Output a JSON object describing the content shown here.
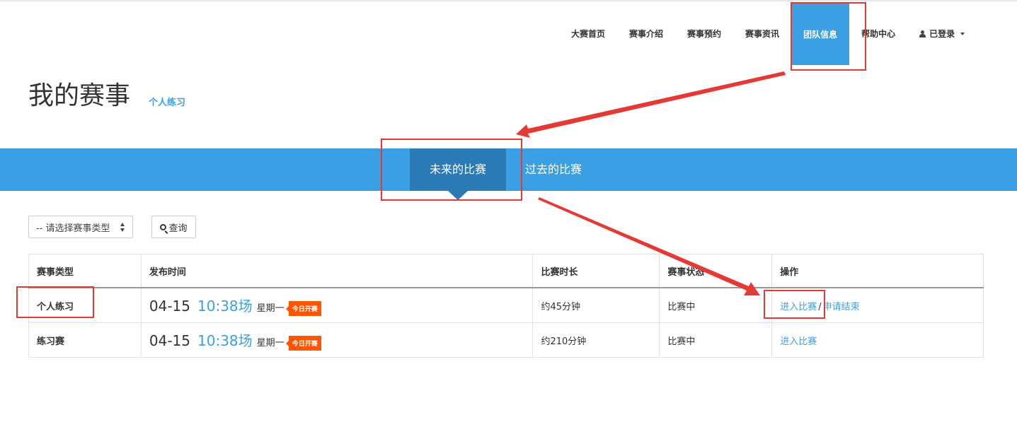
{
  "nav": {
    "items": [
      "大赛首页",
      "赛事介绍",
      "赛事预约",
      "赛事资讯",
      "团队信息",
      "帮助中心"
    ],
    "active": "团队信息",
    "user_label": "已登录"
  },
  "page": {
    "title": "我的赛事",
    "sub_link": "个人练习"
  },
  "tabs": {
    "future": "未来的比赛",
    "past": "过去的比赛"
  },
  "filter": {
    "select_value": "-- 请选择赛事类型",
    "query_label": "查询"
  },
  "table": {
    "headers": [
      "赛事类型",
      "发布时间",
      "比赛时长",
      "赛事状态",
      "操作"
    ],
    "rows": [
      {
        "type": "个人练习",
        "date": "04-15",
        "time": "10:38场",
        "weekday": "星期一",
        "badge": "今日开赛",
        "duration": "约45分钟",
        "status": "比赛中",
        "action1": "进入比赛",
        "sep": "/",
        "action2": "申请结束"
      },
      {
        "type": "练习赛",
        "date": "04-15",
        "time": "10:38场",
        "weekday": "星期一",
        "badge": "今日开赛",
        "duration": "约210分钟",
        "status": "比赛中",
        "action1": "进入比赛"
      }
    ]
  },
  "colors": {
    "accent": "#3b9fe3",
    "tab_active": "#2a7ab5",
    "badge": "#ff5500",
    "highlight": "#e53935"
  }
}
